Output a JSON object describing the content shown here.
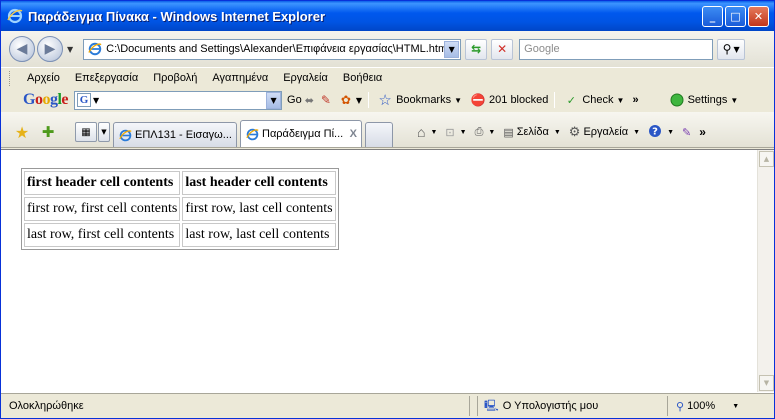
{
  "window": {
    "title": "Παράδειγμα Πίνακα - Windows Internet Explorer",
    "minimize": "_",
    "maximize": "□",
    "close": "✕"
  },
  "address": {
    "url": "C:\\Documents and Settings\\Alexander\\Επιφάνεια εργασίας\\HTML.html",
    "search_placeholder": "Google"
  },
  "menu": {
    "items": [
      "Αρχείο",
      "Επεξεργασία",
      "Προβολή",
      "Αγαπημένα",
      "Εργαλεία",
      "Βοήθεια"
    ]
  },
  "google_toolbar": {
    "logo": "Google",
    "go_label": "Go",
    "bookmarks_label": "Bookmarks",
    "blocked_label": "201 blocked",
    "check_label": "Check",
    "settings_label": "Settings",
    "more": "»"
  },
  "tabs": [
    {
      "label": "ΕΠΛ131 - Εισαγω...",
      "active": false
    },
    {
      "label": "Παράδειγμα Πί...",
      "active": true,
      "close": "X"
    }
  ],
  "command_bar": {
    "page_label": "Σελίδα",
    "tools_label": "Εργαλεία",
    "more": "»"
  },
  "table": {
    "headers": [
      "first header cell contents",
      "last header cell contents"
    ],
    "rows": [
      [
        "first row, first cell contents",
        "first row, last cell contents"
      ],
      [
        "last row, first cell contents",
        "last row, last cell contents"
      ]
    ]
  },
  "status": {
    "left": "Ολοκληρώθηκε",
    "zone": "Ο Υπολογιστής μου",
    "zoom": "100%"
  },
  "colors": {
    "titlebar": "#0054E3",
    "chrome": "#ECE9D8",
    "content_bg": "#FFFFFF"
  }
}
